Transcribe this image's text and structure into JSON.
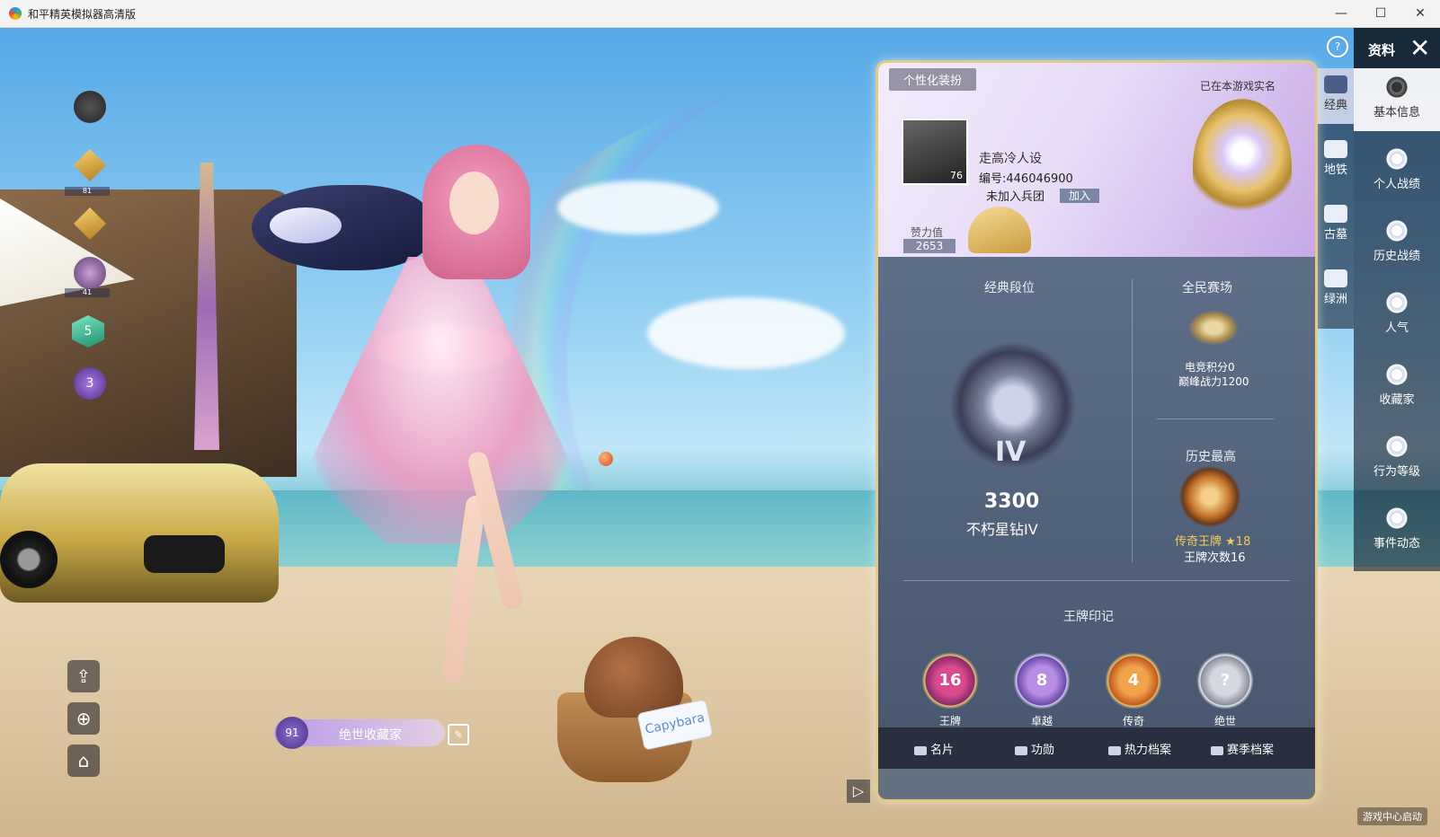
{
  "window": {
    "title": "和平精英模拟器高清版",
    "controls": {
      "minimize": "—",
      "maximize": "☐",
      "close": "✕"
    }
  },
  "hud": {
    "left_icons": [
      {
        "name": "avatar-frame-icon",
        "count": ""
      },
      {
        "name": "rank-gold-icon",
        "count": "81"
      },
      {
        "name": "rank-star-icon",
        "count": ""
      },
      {
        "name": "rank-purple-icon",
        "count": "41"
      },
      {
        "name": "rank-green-icon",
        "count": "5"
      },
      {
        "name": "rank-violet-icon",
        "count": "3"
      }
    ],
    "share_icon": "share-icon",
    "zoom_icon": "zoom-in-icon",
    "home_icon": "home-icon",
    "collector_badge": {
      "level": "91",
      "label": "绝世收藏家"
    },
    "help_label": "?",
    "game_center": "游戏中心启动"
  },
  "side_nav": {
    "title": "资料",
    "close_label": "✕",
    "items": [
      {
        "label": "基本信息",
        "active": true
      },
      {
        "label": "个人战绩",
        "active": false
      },
      {
        "label": "历史战绩",
        "active": false
      },
      {
        "label": "人气",
        "active": false
      },
      {
        "label": "收藏家",
        "active": false
      },
      {
        "label": "行为等级",
        "active": false
      },
      {
        "label": "事件动态",
        "active": false
      }
    ]
  },
  "mode_nav": {
    "items": [
      {
        "label": "经典",
        "active": true
      },
      {
        "label": "地铁",
        "active": false
      },
      {
        "label": "古墓",
        "active": false
      },
      {
        "label": "绿洲",
        "active": false
      }
    ]
  },
  "profile": {
    "tag": "个性化装扮",
    "real_name_status": "已在本游戏实名",
    "avatar_level": "76",
    "name": "走高冷人设",
    "id": "编号:446046900",
    "clan": "未加入兵团",
    "join_button": "加入",
    "power_label": "赞力值",
    "power_value": "2653"
  },
  "rank": {
    "classic_header": "经典段位",
    "classic_tier_numeral": "IV",
    "classic_score": "3300",
    "classic_name": "不朽星钻IV",
    "arena_header": "全民赛场",
    "arena_esports": "电竞积分0",
    "arena_peak": "巅峰战力1200",
    "history_header": "历史最高",
    "history_rank": "传奇王牌",
    "history_stars": "★18",
    "ace_count": "王牌次数16"
  },
  "ace_marks": {
    "header": "王牌印记",
    "items": [
      {
        "label": "王牌",
        "count": "16",
        "color": "#8a2a6a"
      },
      {
        "label": "卓越",
        "count": "8",
        "color": "#6a4aa8"
      },
      {
        "label": "传奇",
        "count": "4",
        "color": "#c25a1e"
      },
      {
        "label": "绝世",
        "count": "?",
        "color": "#8a8f9e"
      }
    ]
  },
  "bottom_tabs": [
    {
      "label": "名片"
    },
    {
      "label": "功勋"
    },
    {
      "label": "热力档案"
    },
    {
      "label": "赛季档案"
    }
  ],
  "colors": {
    "gold": "#f3cb5a",
    "panel_border": "#e6c983"
  }
}
